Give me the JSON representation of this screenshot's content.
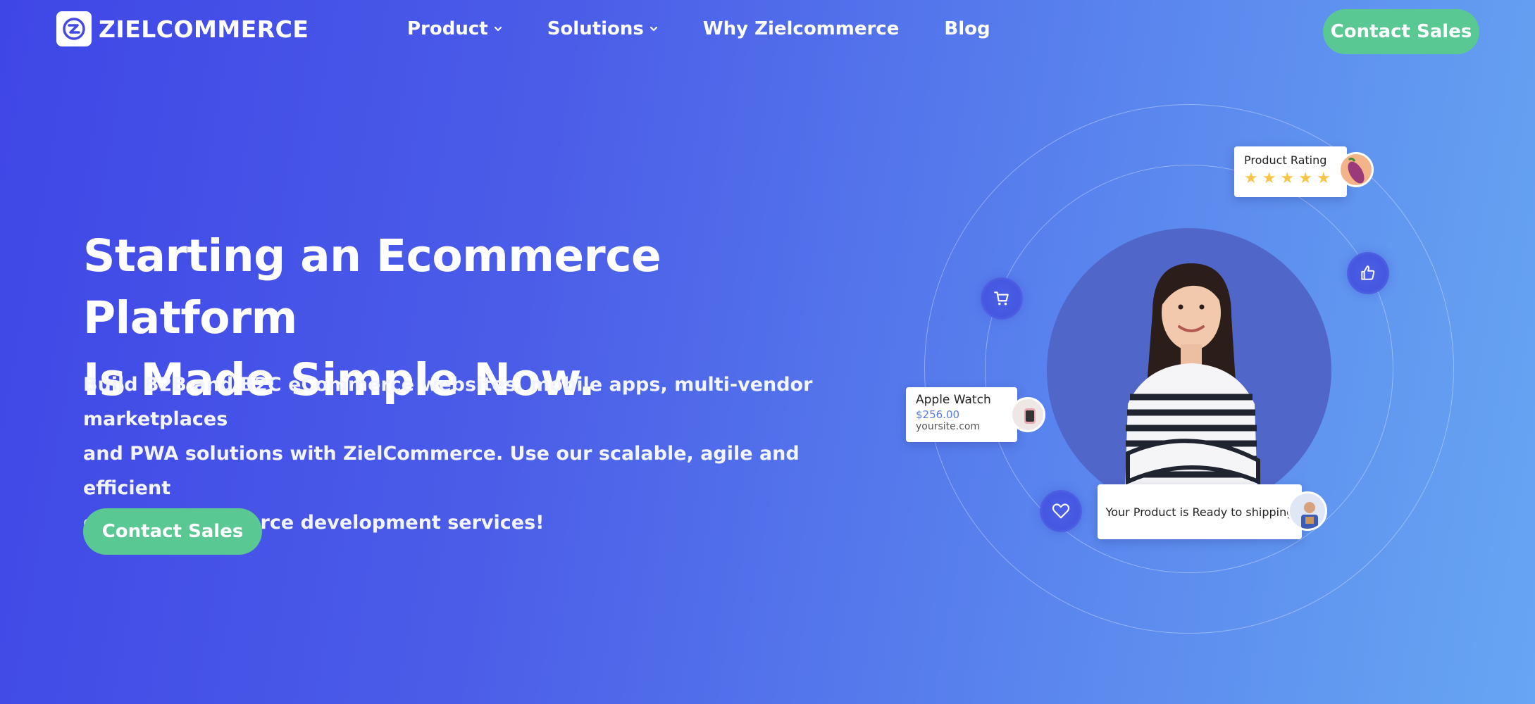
{
  "header": {
    "logo_text": "ZIELCOMMERCE",
    "nav": [
      {
        "label": "Product",
        "has_dropdown": true
      },
      {
        "label": "Solutions",
        "has_dropdown": true
      },
      {
        "label": "Why Zielcommerce",
        "has_dropdown": false
      },
      {
        "label": "Blog",
        "has_dropdown": false
      }
    ],
    "cta_label": "Contact Sales"
  },
  "hero": {
    "title_line1": "Starting an Ecommerce Platform",
    "title_line2": "Is Made Simple Now.",
    "subtitle_line1": "Build B2B and B2C eCommerce websites, mobile apps, multi-vendor marketplaces",
    "subtitle_line2": "and PWA solutions with ZielCommerce. Use our scalable, agile and efficient",
    "subtitle_line3": "custom eCommerce development services!",
    "cta_label": "Contact Sales"
  },
  "illustration": {
    "rating_card": {
      "label": "Product Rating",
      "stars": 5
    },
    "watch_card": {
      "name": "Apple Watch",
      "price": "$256.00",
      "site": "yoursite.com"
    },
    "shipping_card": {
      "text": "Your Product is Ready to shipping"
    },
    "icons": [
      "cart-icon",
      "thumbs-up-icon",
      "heart-icon"
    ]
  },
  "colors": {
    "accent_green": "#5ac892",
    "bg_start": "#3f46e6",
    "bg_end": "#67a6f2",
    "star": "#f6c54a"
  }
}
